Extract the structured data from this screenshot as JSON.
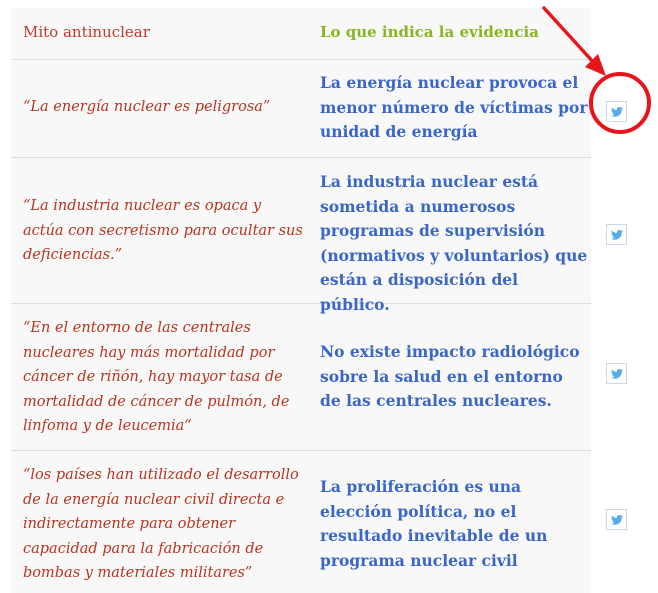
{
  "header": {
    "myth_label": "Mito antinuclear",
    "evidence_label": "Lo que indica la evidencia"
  },
  "rows": [
    {
      "myth": "“La energía nuclear es peligrosa”",
      "evidence": "La energía nuclear provoca el menor número de víctimas por unidad de energía"
    },
    {
      "myth": "“La industria nuclear es opaca y actúa con secretismo para ocultar sus deficiencias.”",
      "evidence": "La industria nuclear está sometida a numerosos programas de supervisión (normativos y voluntarios) que están a disposición del público."
    },
    {
      "myth": "“En el entorno de las centrales nucleares hay más mortalidad por cáncer de riñón, hay mayor tasa de mortalidad de cáncer de pulmón, de linfoma y de leucemia“",
      "evidence": "No existe impacto radiológico sobre la salud en el entorno de las centrales nucleares."
    },
    {
      "myth": "“los países han utilizado el desarrollo de la energía nuclear civil directa e indirectamente para obtener capacidad para la fabricación de bombas y materiales militares”",
      "evidence": "La proliferación es una elección política, no el resultado inevitable de un programa nuclear civil"
    }
  ],
  "icons": {
    "share": "twitter-bird-icon",
    "annotation": "red-arrow-and-circle-highlight"
  },
  "colors": {
    "myth_text": "#b8341f",
    "header_myth": "#c0392b",
    "header_evidence": "#8ab520",
    "evidence_text": "#3a66c8",
    "twitter_blue": "#55acee",
    "annotation_red": "#e8141c",
    "table_bg": "#f8f8f8"
  }
}
